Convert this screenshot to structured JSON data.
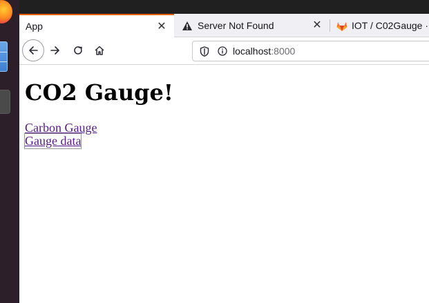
{
  "tabs": [
    {
      "title": "App",
      "active": true
    },
    {
      "title": "Server Not Found",
      "icon": "warning-icon",
      "active": false
    },
    {
      "title": "IOT / C02Gauge ·",
      "icon": "gitlab-icon",
      "active": false
    }
  ],
  "url": {
    "host": "localhost",
    "port": ":8000"
  },
  "page": {
    "heading": "CO2 Gauge!",
    "links": [
      "Carbon Gauge",
      "Gauge data"
    ]
  },
  "colors": {
    "tab_accent": "#e66000",
    "link_visited": "#551a8b"
  }
}
